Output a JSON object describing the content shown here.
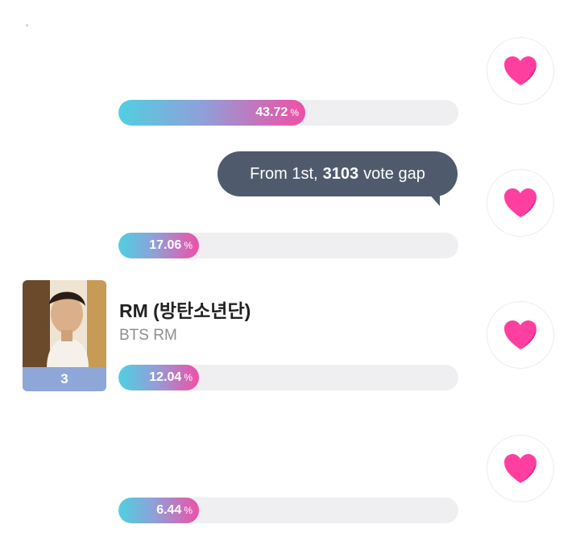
{
  "entries": [
    {
      "percent": "43.72",
      "percent_sign": "%",
      "share": 0.4372
    },
    {
      "percent": "17.06",
      "percent_sign": "%",
      "share": 0.1706
    },
    {
      "percent": "12.04",
      "percent_sign": "%",
      "share": 0.1204,
      "rank": "3",
      "name": "RM (방탄소년단)",
      "subtitle": "BTS RM"
    },
    {
      "percent": "6.44",
      "percent_sign": "%",
      "share": 0.0644
    }
  ],
  "tooltip": {
    "prefix": "From 1st,",
    "gap": "3103",
    "suffix": "vote gap"
  },
  "colors": {
    "bar_start": "#4fd0e0",
    "bar_end": "#f04fa6",
    "heart": "#ff3fa0",
    "tooltip_bg": "#4f5b6d",
    "rank_badge": "#8ea7d8"
  },
  "icons": {
    "vote": "heart-icon"
  }
}
